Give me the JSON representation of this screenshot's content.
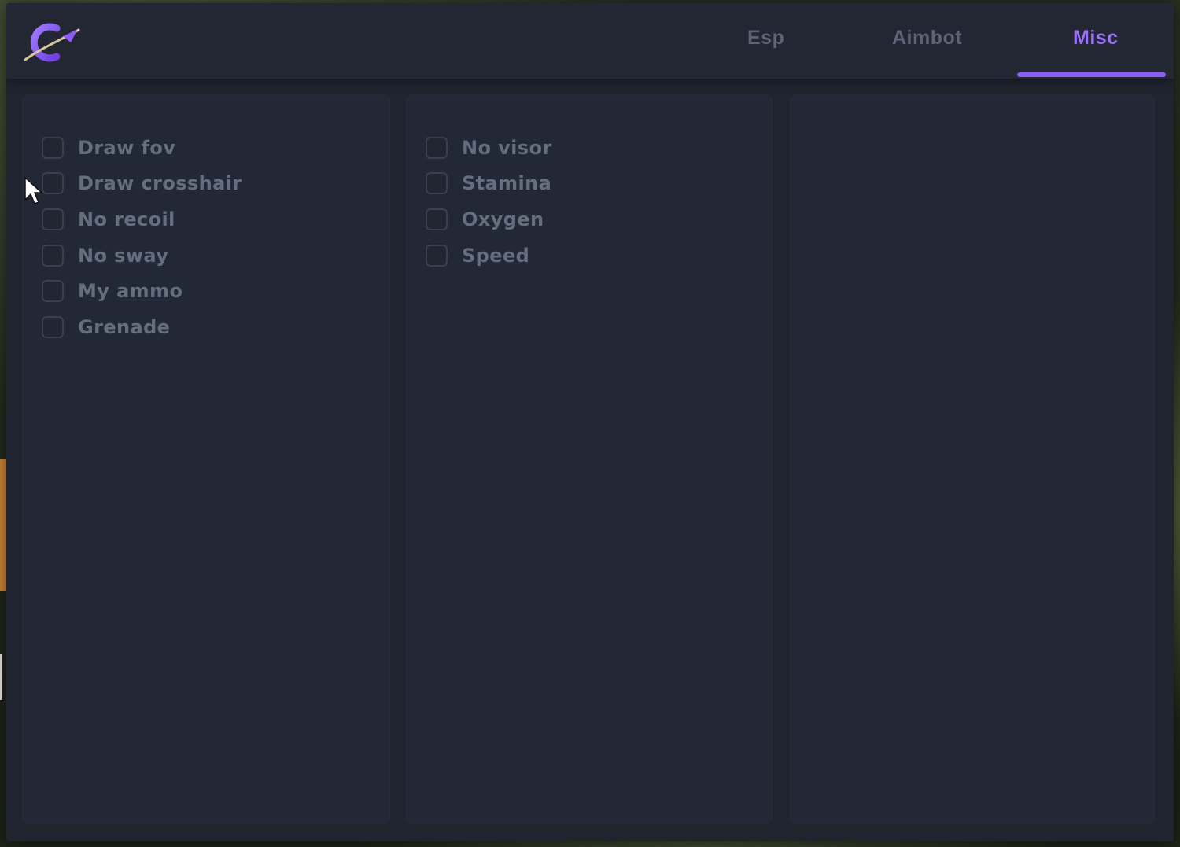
{
  "tabs": [
    {
      "label": "Esp",
      "active": false
    },
    {
      "label": "Aimbot",
      "active": false
    },
    {
      "label": "Misc",
      "active": true
    }
  ],
  "columns": [
    {
      "options": [
        "Draw fov",
        "Draw crosshair",
        "No recoil",
        "No sway",
        "My ammo",
        "Grenade"
      ]
    },
    {
      "options": [
        "No visor",
        "Stamina",
        "Oxygen",
        "Speed"
      ]
    },
    {
      "options": []
    }
  ],
  "colors": {
    "accent": "#8b5cf6",
    "accent_light": "#9b72f5",
    "inactive_tab": "#5d6476",
    "label": "#666d7e"
  },
  "icons": {
    "logo": "planet-c-logo-icon",
    "cursor": "mouse-pointer-icon"
  }
}
